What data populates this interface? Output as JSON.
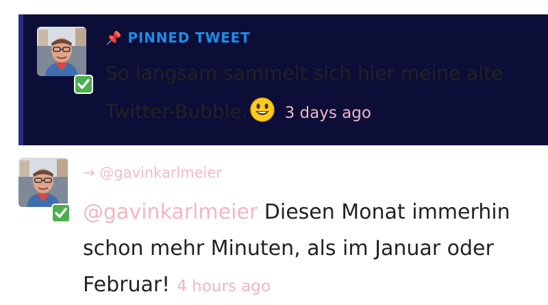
{
  "pinned": {
    "label": "PINNED TWEET",
    "pin_icon": "pushpin-icon",
    "text": "So langsam sammelt sich hier meine alte Twitter-Bubble.",
    "emoji": "smiley-face-emoji",
    "time": "3 days ago"
  },
  "reply": {
    "reply_to": "→ @gavinkarlmeier",
    "mention": "@gavinkarlmeier",
    "text": " Diesen Monat immerhin schon mehr Minuten, als im Januar oder Februar!",
    "time": "4 hours ago"
  },
  "colors": {
    "pinned_bg": "#0d0e38",
    "accent_blue": "#1a8fe8",
    "pink": "#f4b6c2",
    "verified_green": "#4caf50"
  }
}
